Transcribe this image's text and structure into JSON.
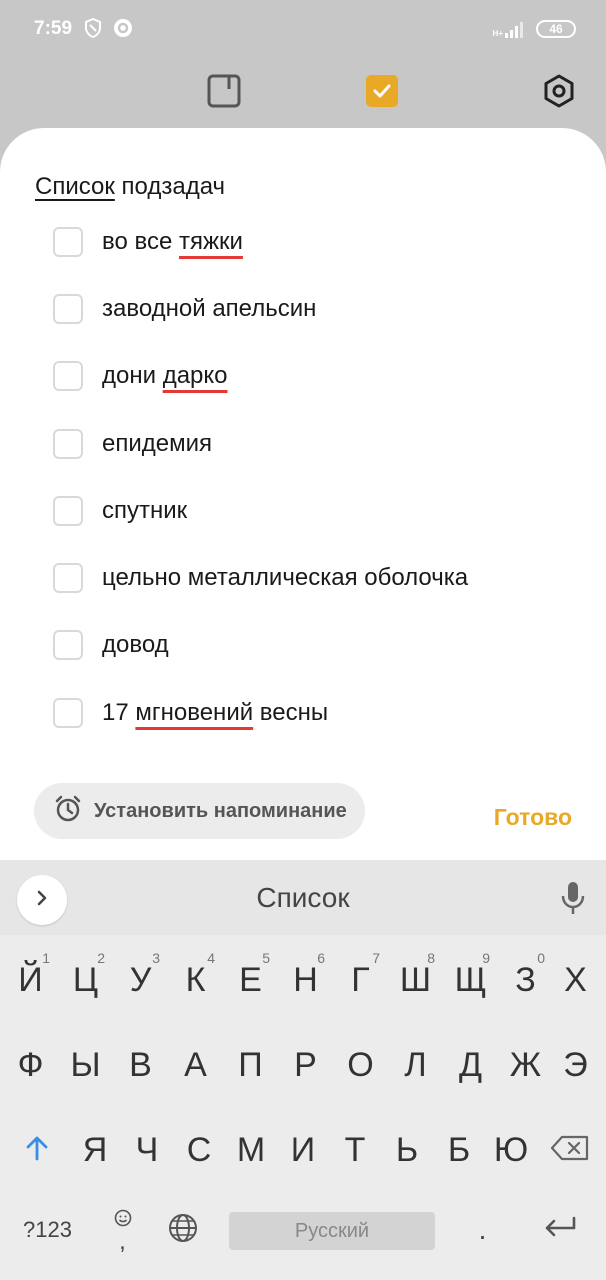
{
  "status_bar": {
    "time": "7:59",
    "battery": "46",
    "network": "H+"
  },
  "toolbar": {
    "left_icon": "note-icon",
    "center_icon": "checklist-icon",
    "right_icon": "settings-icon",
    "accent_color": "#e9a826"
  },
  "sheet": {
    "title_underlined": "Список",
    "title_rest": " подзадач",
    "items": [
      {
        "text_before": "во все ",
        "text_spell": "тяжки",
        "text_after": ""
      },
      {
        "text_before": "заводной апельсин",
        "text_spell": "",
        "text_after": ""
      },
      {
        "text_before": "дони ",
        "text_spell": "дарко",
        "text_after": ""
      },
      {
        "text_before": "епидемия",
        "text_spell": "",
        "text_after": ""
      },
      {
        "text_before": "спутник",
        "text_spell": "",
        "text_after": ""
      },
      {
        "text_before": "цельно металлическая оболочка",
        "text_spell": "",
        "text_after": ""
      },
      {
        "text_before": "довод",
        "text_spell": "",
        "text_after": ""
      },
      {
        "text_before": "17 ",
        "text_spell": "мгновений",
        "text_after": " весны"
      }
    ],
    "reminder_label": "Установить напоминание",
    "done_label": "Готово"
  },
  "keyboard": {
    "suggestion": "Список",
    "row1": [
      {
        "k": "Й",
        "s": "1"
      },
      {
        "k": "Ц",
        "s": "2"
      },
      {
        "k": "У",
        "s": "3"
      },
      {
        "k": "К",
        "s": "4"
      },
      {
        "k": "Е",
        "s": "5"
      },
      {
        "k": "Н",
        "s": "6"
      },
      {
        "k": "Г",
        "s": "7"
      },
      {
        "k": "Ш",
        "s": "8"
      },
      {
        "k": "Щ",
        "s": "9"
      },
      {
        "k": "З",
        "s": "0"
      },
      {
        "k": "Х",
        "s": ""
      }
    ],
    "row2": [
      "Ф",
      "Ы",
      "В",
      "А",
      "П",
      "Р",
      "О",
      "Л",
      "Д",
      "Ж",
      "Э"
    ],
    "row3": [
      "Я",
      "Ч",
      "С",
      "М",
      "И",
      "Т",
      "Ь",
      "Б",
      "Ю"
    ],
    "sym_label": "?123",
    "comma": ",",
    "space_label": "Русский",
    "period": "."
  }
}
